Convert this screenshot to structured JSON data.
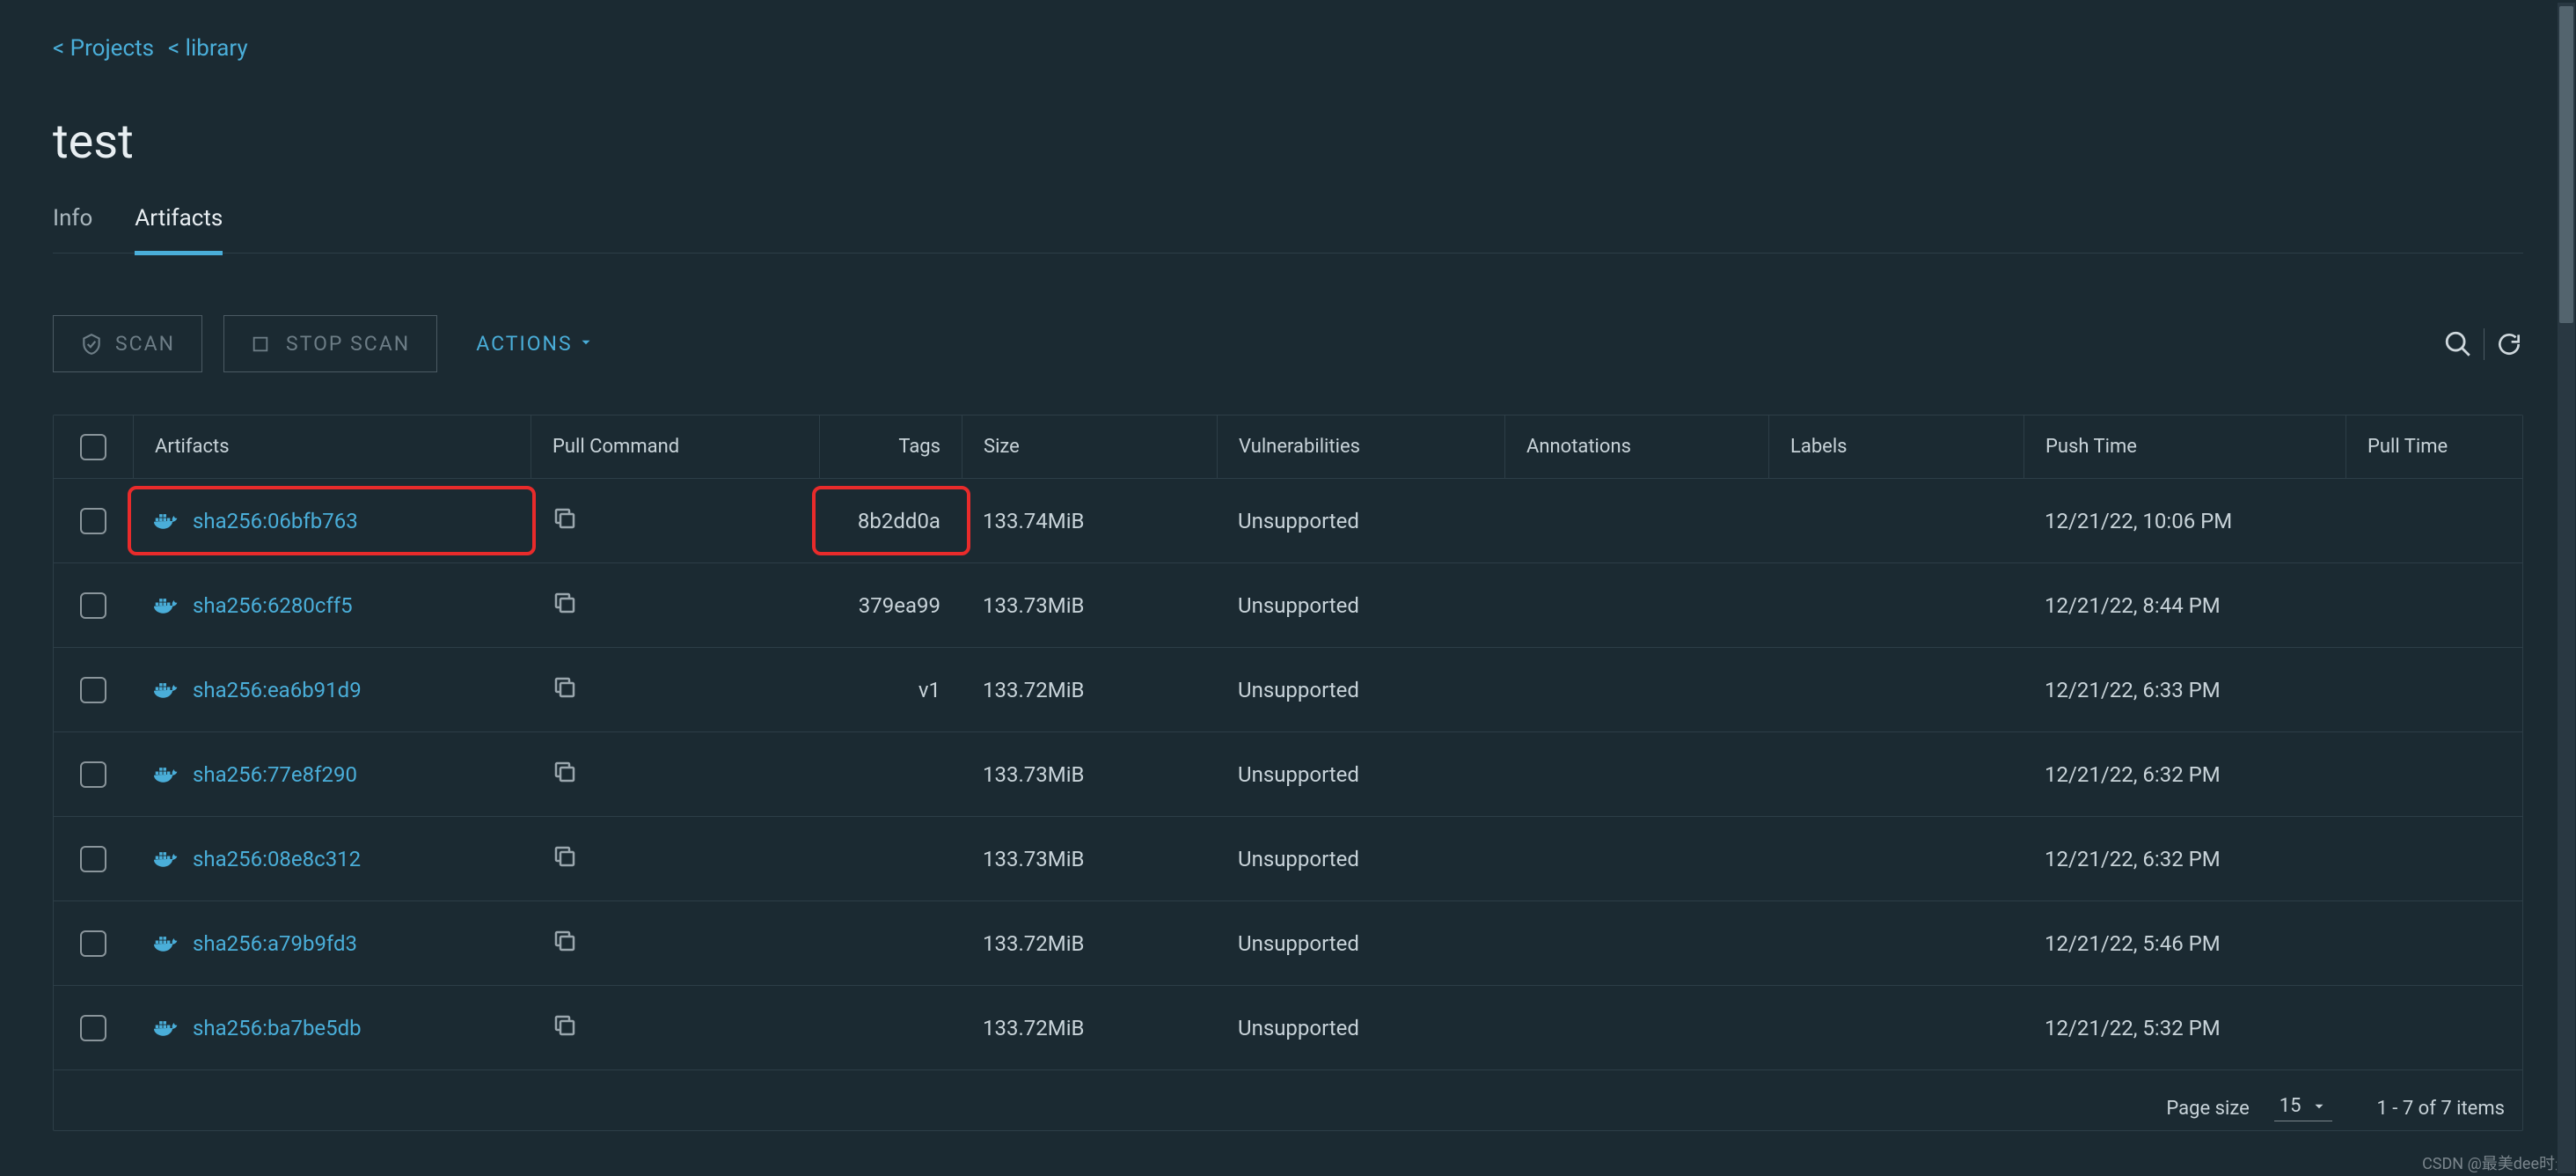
{
  "breadcrumbs": {
    "projects": "< Projects",
    "library": "< library"
  },
  "title": "test",
  "tabs": {
    "info": "Info",
    "artifacts": "Artifacts"
  },
  "toolbar": {
    "scan": "SCAN",
    "stop_scan": "STOP SCAN",
    "actions": "ACTIONS"
  },
  "columns": {
    "artifacts": "Artifacts",
    "pull_command": "Pull Command",
    "tags": "Tags",
    "size": "Size",
    "vulnerabilities": "Vulnerabilities",
    "annotations": "Annotations",
    "labels": "Labels",
    "push_time": "Push Time",
    "pull_time": "Pull Time"
  },
  "rows": [
    {
      "artifact": "sha256:06bfb763",
      "tag": "8b2dd0a",
      "size": "133.74MiB",
      "vuln": "Unsupported",
      "push": "12/21/22, 10:06 PM",
      "highlight": true
    },
    {
      "artifact": "sha256:6280cff5",
      "tag": "379ea99",
      "size": "133.73MiB",
      "vuln": "Unsupported",
      "push": "12/21/22, 8:44 PM"
    },
    {
      "artifact": "sha256:ea6b91d9",
      "tag": "v1",
      "size": "133.72MiB",
      "vuln": "Unsupported",
      "push": "12/21/22, 6:33 PM"
    },
    {
      "artifact": "sha256:77e8f290",
      "tag": "",
      "size": "133.73MiB",
      "vuln": "Unsupported",
      "push": "12/21/22, 6:32 PM"
    },
    {
      "artifact": "sha256:08e8c312",
      "tag": "",
      "size": "133.73MiB",
      "vuln": "Unsupported",
      "push": "12/21/22, 6:32 PM"
    },
    {
      "artifact": "sha256:a79b9fd3",
      "tag": "",
      "size": "133.72MiB",
      "vuln": "Unsupported",
      "push": "12/21/22, 5:46 PM"
    },
    {
      "artifact": "sha256:ba7be5db",
      "tag": "",
      "size": "133.72MiB",
      "vuln": "Unsupported",
      "push": "12/21/22, 5:32 PM"
    }
  ],
  "footer": {
    "page_size_label": "Page size",
    "page_size_value": "15",
    "items_range": "1 - 7 of 7 items"
  },
  "watermark": "CSDN @最美dee时光"
}
